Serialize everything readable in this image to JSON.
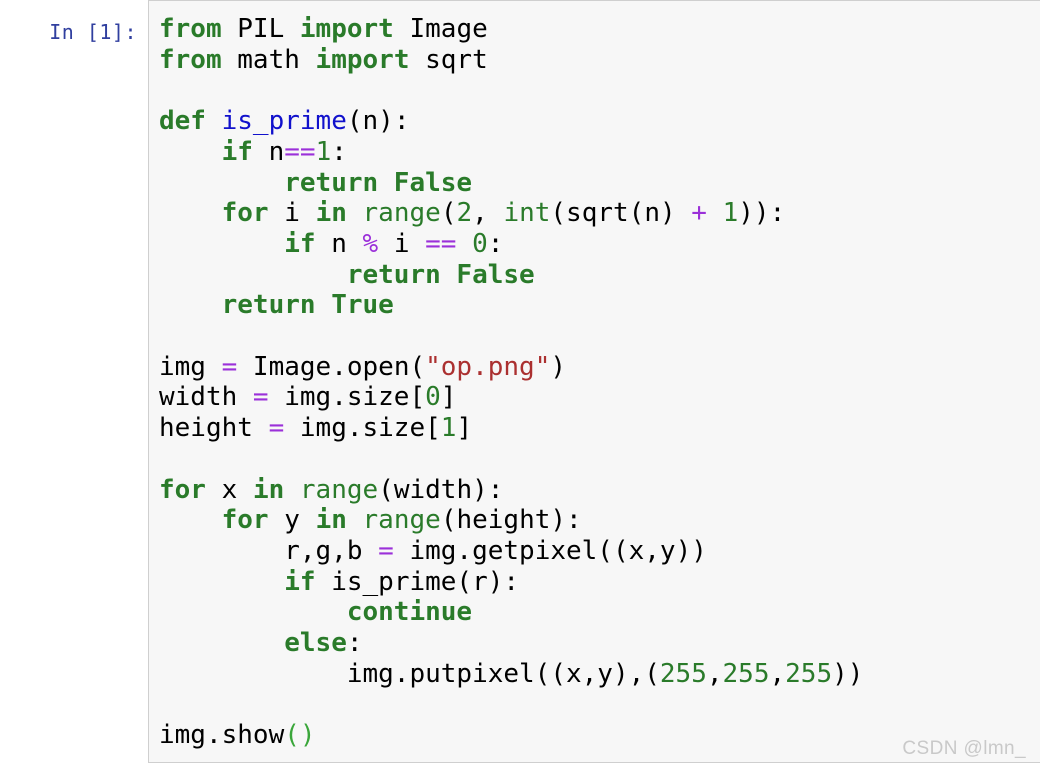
{
  "cell": {
    "prompt": "In [1]:",
    "language": "python",
    "background_color": "#f7f7f7",
    "border_color": "#cfcfcf",
    "prompt_color": "#303f9f"
  },
  "colors": {
    "keyword": "#2a7b2a",
    "function_name": "#1111cc",
    "builtin": "#2a7b2a",
    "number": "#2a7b2a",
    "string": "#ab3030",
    "operator": "#9b30d9",
    "plain": "#000000",
    "watermark": "#c9c9c9"
  },
  "watermark": {
    "text": "CSDN @lmn_"
  },
  "code": {
    "plain_text": "from PIL import Image\nfrom math import sqrt\n\ndef is_prime(n):\n    if n==1:\n        return False\n    for i in range(2, int(sqrt(n) + 1)):\n        if n % i == 0:\n            return False\n    return True\n\nimg = Image.open(\"op.png\")\nwidth = img.size[0]\nheight = img.size[1]\n\nfor x in range(width):\n    for y in range(height):\n        r,g,b = img.getpixel((x,y))\n        if is_prime(r):\n            continue\n        else:\n            img.putpixel((x,y),(255,255,255))\n\nimg.show()",
    "lines": [
      {
        "n": 1,
        "text": "from PIL import Image",
        "tokens": [
          {
            "t": "from",
            "c": "k"
          },
          {
            "t": " PIL ",
            "c": "n"
          },
          {
            "t": "import",
            "c": "k"
          },
          {
            "t": " Image",
            "c": "n"
          }
        ]
      },
      {
        "n": 2,
        "text": "from math import sqrt",
        "tokens": [
          {
            "t": "from",
            "c": "k"
          },
          {
            "t": " math ",
            "c": "n"
          },
          {
            "t": "import",
            "c": "k"
          },
          {
            "t": " sqrt",
            "c": "n"
          }
        ]
      },
      {
        "n": 3,
        "text": "",
        "tokens": []
      },
      {
        "n": 4,
        "text": "def is_prime(n):",
        "tokens": [
          {
            "t": "def",
            "c": "k"
          },
          {
            "t": " ",
            "c": "n"
          },
          {
            "t": "is_prime",
            "c": "nf"
          },
          {
            "t": "(n):",
            "c": "p"
          }
        ]
      },
      {
        "n": 5,
        "text": "    if n==1:",
        "tokens": [
          {
            "t": "    ",
            "c": "n"
          },
          {
            "t": "if",
            "c": "k"
          },
          {
            "t": " n",
            "c": "n"
          },
          {
            "t": "==",
            "c": "o"
          },
          {
            "t": "1",
            "c": "mi"
          },
          {
            "t": ":",
            "c": "p"
          }
        ]
      },
      {
        "n": 6,
        "text": "        return False",
        "tokens": [
          {
            "t": "        ",
            "c": "n"
          },
          {
            "t": "return False",
            "c": "k"
          }
        ]
      },
      {
        "n": 7,
        "text": "    for i in range(2, int(sqrt(n) + 1)):",
        "tokens": [
          {
            "t": "    ",
            "c": "n"
          },
          {
            "t": "for",
            "c": "k"
          },
          {
            "t": " i ",
            "c": "n"
          },
          {
            "t": "in",
            "c": "k"
          },
          {
            "t": " ",
            "c": "n"
          },
          {
            "t": "range",
            "c": "nb"
          },
          {
            "t": "(",
            "c": "p"
          },
          {
            "t": "2",
            "c": "mi"
          },
          {
            "t": ", ",
            "c": "p"
          },
          {
            "t": "int",
            "c": "nb"
          },
          {
            "t": "(sqrt(n) ",
            "c": "p"
          },
          {
            "t": "+",
            "c": "o"
          },
          {
            "t": " ",
            "c": "n"
          },
          {
            "t": "1",
            "c": "mi"
          },
          {
            "t": ")):",
            "c": "p"
          }
        ]
      },
      {
        "n": 8,
        "text": "        if n % i == 0:",
        "tokens": [
          {
            "t": "        ",
            "c": "n"
          },
          {
            "t": "if",
            "c": "k"
          },
          {
            "t": " n ",
            "c": "n"
          },
          {
            "t": "%",
            "c": "o"
          },
          {
            "t": " i ",
            "c": "n"
          },
          {
            "t": "==",
            "c": "o"
          },
          {
            "t": " ",
            "c": "n"
          },
          {
            "t": "0",
            "c": "mi"
          },
          {
            "t": ":",
            "c": "p"
          }
        ]
      },
      {
        "n": 9,
        "text": "            return False",
        "tokens": [
          {
            "t": "            ",
            "c": "n"
          },
          {
            "t": "return False",
            "c": "k"
          }
        ]
      },
      {
        "n": 10,
        "text": "    return True",
        "tokens": [
          {
            "t": "    ",
            "c": "n"
          },
          {
            "t": "return True",
            "c": "k"
          }
        ]
      },
      {
        "n": 11,
        "text": "",
        "tokens": []
      },
      {
        "n": 12,
        "text": "img = Image.open(\"op.png\")",
        "tokens": [
          {
            "t": "img ",
            "c": "n"
          },
          {
            "t": "=",
            "c": "o"
          },
          {
            "t": " Image.open(",
            "c": "p"
          },
          {
            "t": "\"op.png\"",
            "c": "s"
          },
          {
            "t": ")",
            "c": "p"
          }
        ]
      },
      {
        "n": 13,
        "text": "width = img.size[0]",
        "tokens": [
          {
            "t": "width ",
            "c": "n"
          },
          {
            "t": "=",
            "c": "o"
          },
          {
            "t": " img.size[",
            "c": "p"
          },
          {
            "t": "0",
            "c": "mi"
          },
          {
            "t": "]",
            "c": "p"
          }
        ]
      },
      {
        "n": 14,
        "text": "height = img.size[1]",
        "tokens": [
          {
            "t": "height ",
            "c": "n"
          },
          {
            "t": "=",
            "c": "o"
          },
          {
            "t": " img.size[",
            "c": "p"
          },
          {
            "t": "1",
            "c": "mi"
          },
          {
            "t": "]",
            "c": "p"
          }
        ]
      },
      {
        "n": 15,
        "text": "",
        "tokens": []
      },
      {
        "n": 16,
        "text": "for x in range(width):",
        "tokens": [
          {
            "t": "for",
            "c": "k"
          },
          {
            "t": " x ",
            "c": "n"
          },
          {
            "t": "in",
            "c": "k"
          },
          {
            "t": " ",
            "c": "n"
          },
          {
            "t": "range",
            "c": "nb"
          },
          {
            "t": "(width):",
            "c": "p"
          }
        ]
      },
      {
        "n": 17,
        "text": "    for y in range(height):",
        "tokens": [
          {
            "t": "    ",
            "c": "n"
          },
          {
            "t": "for",
            "c": "k"
          },
          {
            "t": " y ",
            "c": "n"
          },
          {
            "t": "in",
            "c": "k"
          },
          {
            "t": " ",
            "c": "n"
          },
          {
            "t": "range",
            "c": "nb"
          },
          {
            "t": "(height):",
            "c": "p"
          }
        ]
      },
      {
        "n": 18,
        "text": "        r,g,b = img.getpixel((x,y))",
        "tokens": [
          {
            "t": "        r,g,b ",
            "c": "n"
          },
          {
            "t": "=",
            "c": "o"
          },
          {
            "t": " img.getpixel((x,y))",
            "c": "p"
          }
        ]
      },
      {
        "n": 19,
        "text": "        if is_prime(r):",
        "tokens": [
          {
            "t": "        ",
            "c": "n"
          },
          {
            "t": "if",
            "c": "k"
          },
          {
            "t": " is_prime(r):",
            "c": "p"
          }
        ]
      },
      {
        "n": 20,
        "text": "            continue",
        "tokens": [
          {
            "t": "            ",
            "c": "n"
          },
          {
            "t": "continue",
            "c": "k"
          }
        ]
      },
      {
        "n": 21,
        "text": "        else:",
        "tokens": [
          {
            "t": "        ",
            "c": "n"
          },
          {
            "t": "else",
            "c": "k"
          },
          {
            "t": ":",
            "c": "p"
          }
        ]
      },
      {
        "n": 22,
        "text": "            img.putpixel((x,y),(255,255,255))",
        "tokens": [
          {
            "t": "            img.putpixel((x,y),(",
            "c": "p"
          },
          {
            "t": "255",
            "c": "mi"
          },
          {
            "t": ",",
            "c": "p"
          },
          {
            "t": "255",
            "c": "mi"
          },
          {
            "t": ",",
            "c": "p"
          },
          {
            "t": "255",
            "c": "mi"
          },
          {
            "t": "))",
            "c": "p"
          }
        ]
      },
      {
        "n": 23,
        "text": "",
        "tokens": []
      },
      {
        "n": 24,
        "text": "img.show()",
        "tokens": [
          {
            "t": "img.show",
            "c": "p"
          },
          {
            "t": "()",
            "c": "pg"
          }
        ]
      }
    ]
  }
}
